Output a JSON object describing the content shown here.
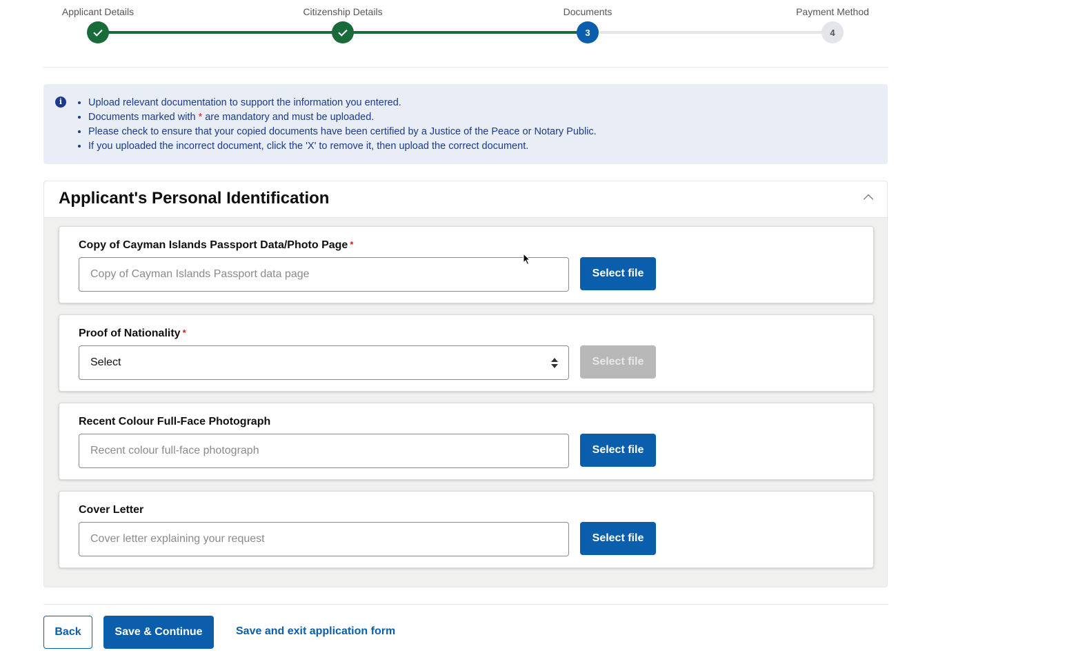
{
  "stepper": {
    "steps": [
      {
        "label": "Applicant Details",
        "state": "done",
        "number": ""
      },
      {
        "label": "Citizenship Details",
        "state": "done",
        "number": ""
      },
      {
        "label": "Documents",
        "state": "current",
        "number": "3"
      },
      {
        "label": "Payment Method",
        "state": "todo",
        "number": "4"
      }
    ]
  },
  "info": {
    "icon": "info-icon",
    "items": [
      "Upload relevant documentation to support the information you entered.",
      "Documents marked with ",
      "Please check to ensure that your copied documents have been certified by a Justice of the Peace or Notary Public.",
      "If you uploaded the incorrect document, click the 'X' to remove it, then upload the correct document."
    ],
    "mandatory_star": "*",
    "mandatory_suffix": " are mandatory and must be uploaded."
  },
  "section": {
    "title": "Applicant's Personal Identification",
    "documents": [
      {
        "label": "Copy of Cayman Islands Passport Data/Photo Page",
        "required": "*",
        "placeholder": "Copy of Cayman Islands Passport data page",
        "button": "Select file"
      },
      {
        "label": "Proof of Nationality",
        "required": "*",
        "select_value": "Select",
        "button": "Select file"
      },
      {
        "label": "Recent Colour Full-Face Photograph",
        "placeholder": "Recent colour full-face photograph",
        "button": "Select file"
      },
      {
        "label": "Cover Letter",
        "placeholder": "Cover letter explaining your request",
        "button": "Select file"
      }
    ]
  },
  "footer": {
    "back": "Back",
    "save_continue": "Save & Continue",
    "save_exit": "Save and exit application form"
  },
  "colors": {
    "primary": "#0a5eab",
    "done": "#1a6b3a",
    "info_bg": "#e8edf6",
    "required": "#cc1f1f"
  }
}
